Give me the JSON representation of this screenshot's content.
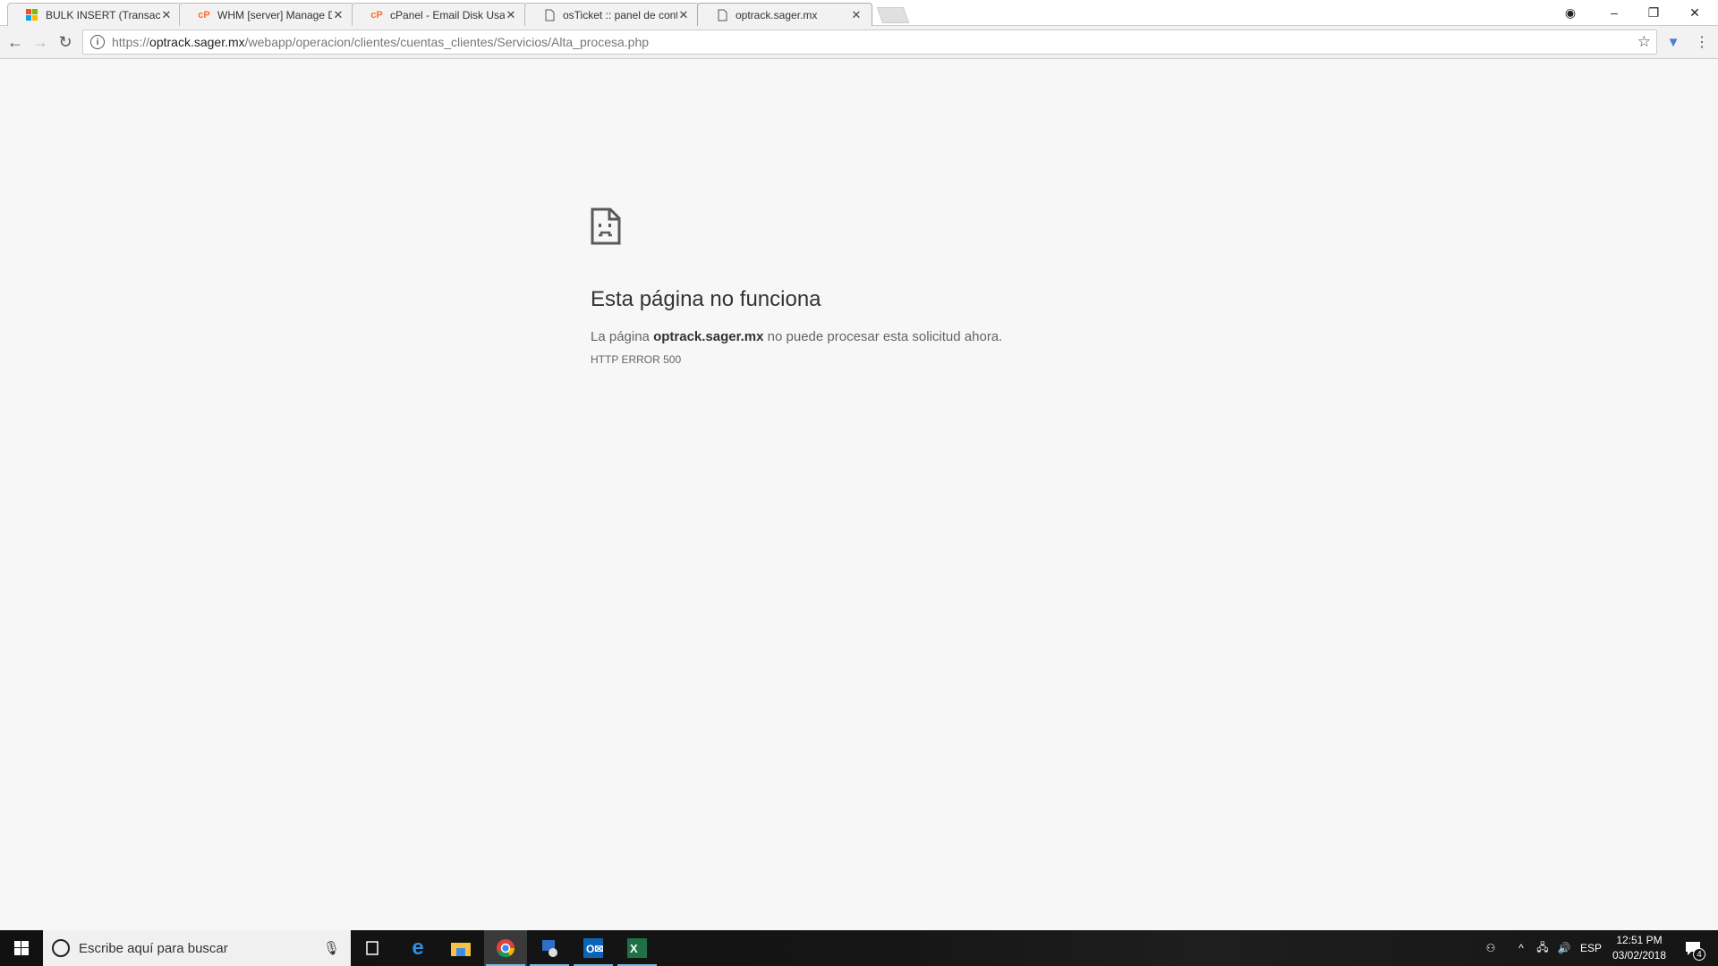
{
  "browser": {
    "tabs": [
      {
        "title": "BULK INSERT (Transact-SQL)",
        "icon": "microsoft-icon"
      },
      {
        "title": "WHM [server] Manage Disk",
        "icon": "cpanel-icon"
      },
      {
        "title": "cPanel - Email Disk Usage",
        "icon": "cpanel-icon"
      },
      {
        "title": "osTicket :: panel de control",
        "icon": "page-icon"
      },
      {
        "title": "optrack.sager.mx",
        "icon": "page-icon",
        "active": true
      }
    ],
    "url_scheme": "https://",
    "url_host": "optrack.sager.mx",
    "url_path": "/webapp/operacion/clientes/cuentas_clientes/Servicios/Alta_procesa.php"
  },
  "error": {
    "title": "Esta página no funciona",
    "desc_prefix": "La página ",
    "desc_host": "optrack.sager.mx",
    "desc_suffix": " no puede procesar esta solicitud ahora.",
    "code": "HTTP ERROR 500"
  },
  "taskbar": {
    "search_placeholder": "Escribe aquí para buscar",
    "language": "ESP",
    "time": "12:51 PM",
    "date": "03/02/2018",
    "notifications": "4"
  }
}
